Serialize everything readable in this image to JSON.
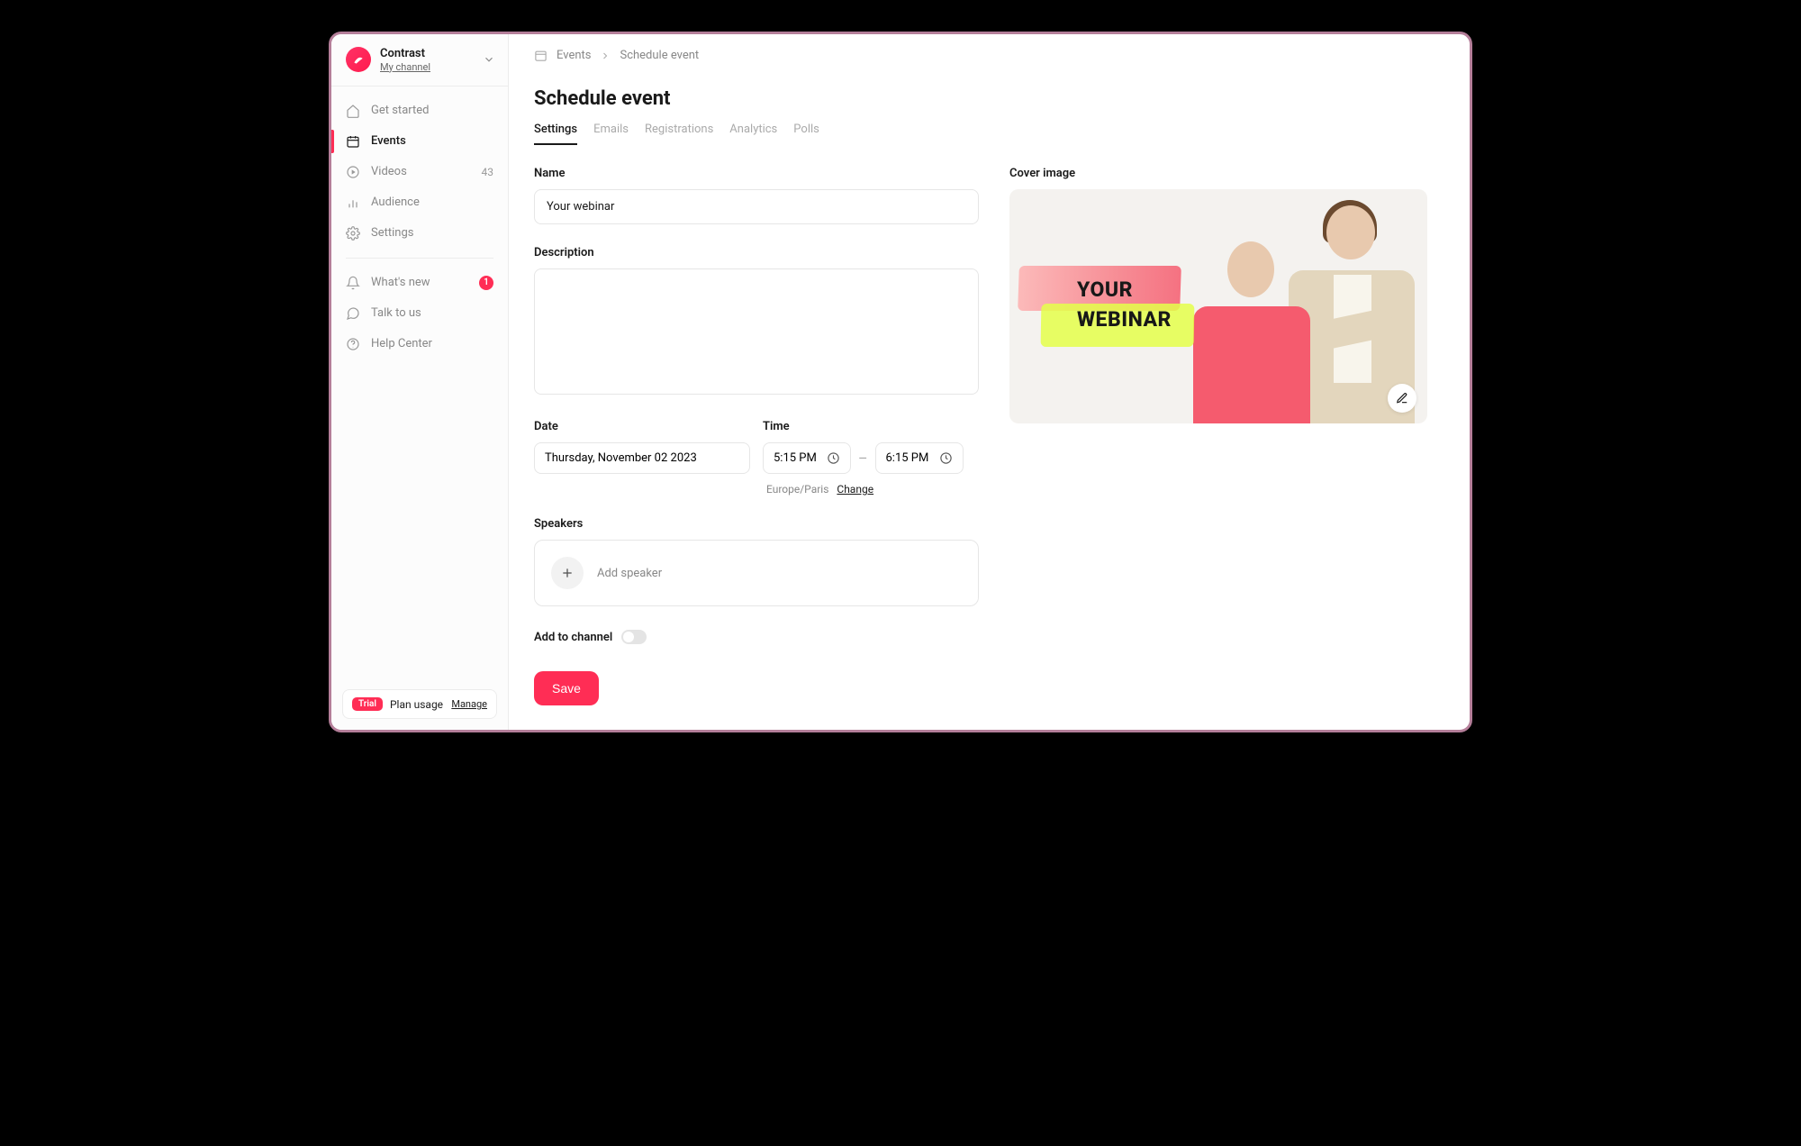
{
  "sidebar": {
    "channel_name": "Contrast",
    "channel_subtitle": "My channel",
    "nav": {
      "get_started": "Get started",
      "events": "Events",
      "videos": "Videos",
      "videos_count": "43",
      "audience": "Audience",
      "settings": "Settings",
      "whats_new": "What's new",
      "whats_new_badge": "1",
      "talk_to_us": "Talk to us",
      "help_center": "Help Center"
    },
    "plan": {
      "trial_label": "Trial",
      "usage_label": "Plan usage",
      "manage_label": "Manage"
    }
  },
  "breadcrumb": {
    "events": "Events",
    "current": "Schedule event"
  },
  "page": {
    "title": "Schedule event"
  },
  "tabs": {
    "settings": "Settings",
    "emails": "Emails",
    "registrations": "Registrations",
    "analytics": "Analytics",
    "polls": "Polls"
  },
  "form": {
    "name_label": "Name",
    "name_value": "Your webinar",
    "description_label": "Description",
    "description_value": "",
    "date_label": "Date",
    "date_value": "Thursday, November 02 2023",
    "time_label": "Time",
    "time_start": "5:15 PM",
    "time_end": "6:15 PM",
    "time_dash": "–",
    "timezone": "Europe/Paris",
    "timezone_change": "Change",
    "speakers_label": "Speakers",
    "add_speaker": "Add speaker",
    "add_to_channel": "Add to channel",
    "save": "Save"
  },
  "cover": {
    "label": "Cover image",
    "line1": "YOUR",
    "line2": "WEBINAR"
  }
}
